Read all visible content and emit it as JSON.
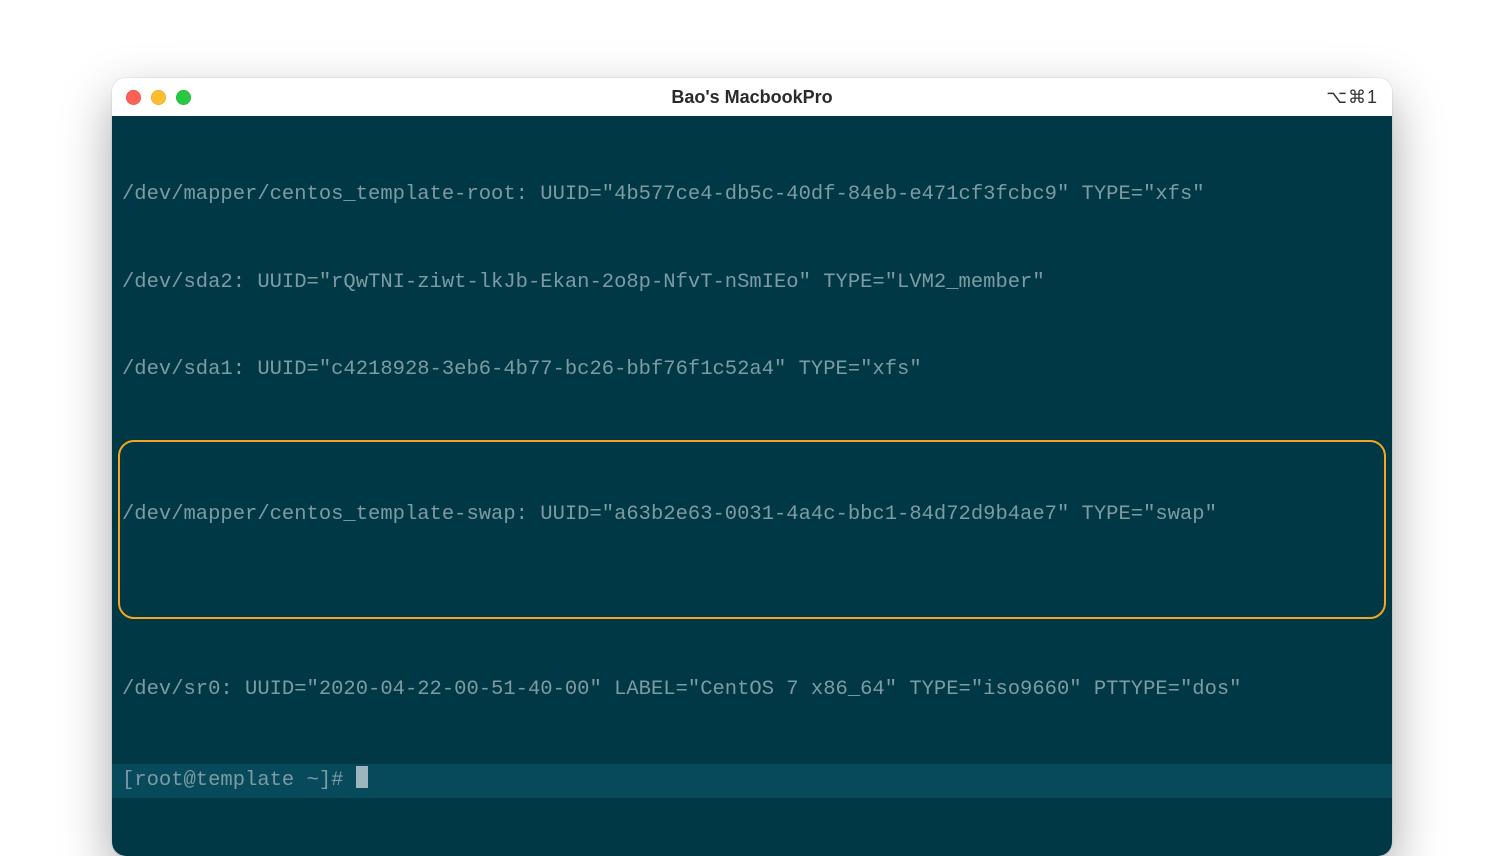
{
  "window": {
    "title": "Bao's MacbookPro",
    "shortcut": "⌥⌘1"
  },
  "colors": {
    "term_bg": "#003845",
    "term_fg": "#7d9ba3",
    "prompt_bg": "#064a5b",
    "highlight": "#f5a623",
    "close": "#ff5f57",
    "minimize": "#febc2e",
    "zoom": "#28c840"
  },
  "terminal": {
    "lines": [
      "/dev/mapper/centos_template-root: UUID=\"4b577ce4-db5c-40df-84eb-e471cf3fcbc9\" TYPE=\"xfs\"",
      "/dev/sda2: UUID=\"rQwTNI-ziwt-lkJb-Ekan-2o8p-NfvT-nSmIEo\" TYPE=\"LVM2_member\"",
      "/dev/sda1: UUID=\"c4218928-3eb6-4b77-bc26-bbf76f1c52a4\" TYPE=\"xfs\"",
      "/dev/mapper/centos_template-swap: UUID=\"a63b2e63-0031-4a4c-bbc1-84d72d9b4ae7\" TYPE=\"swap\"",
      "/dev/sr0: UUID=\"2020-04-22-00-51-40-00\" LABEL=\"CentOS 7 x86_64\" TYPE=\"iso9660\" PTTYPE=\"dos\""
    ],
    "highlighted_index": 3,
    "prompt": "[root@template ~]# "
  }
}
